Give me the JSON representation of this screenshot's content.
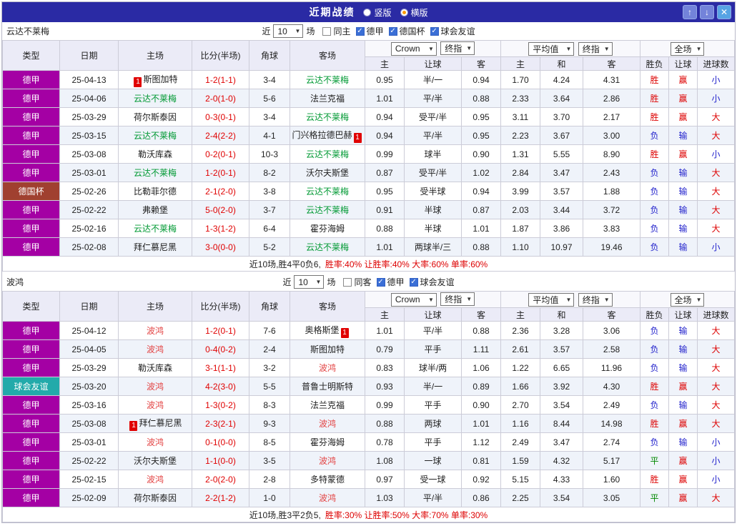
{
  "colors": {
    "type": {
      "德甲": "#a400a4",
      "德国杯": "#a04030",
      "球会友谊": "#22aaaa"
    },
    "result": {
      "胜": "#dd0000",
      "平": "#008800",
      "负": "#2222cc",
      "赢": "#dd0000",
      "输": "#2222cc",
      "大": "#dd0000",
      "小": "#2222cc"
    },
    "score": "#e00000",
    "titlebar_bg": "#2a2aa4"
  },
  "titlebar": {
    "title": "近期战绩",
    "layout_options": [
      {
        "label": "竖版",
        "selected": false
      },
      {
        "label": "横版",
        "selected": true
      }
    ],
    "up_icon": "↑",
    "down_icon": "↓",
    "close_icon": "✕"
  },
  "columns": {
    "type": "类型",
    "date": "日期",
    "home": "主场",
    "score": "比分(半场)",
    "corner": "角球",
    "away": "客场",
    "ah": [
      "主",
      "让球",
      "客"
    ],
    "eu": [
      "主",
      "和",
      "客"
    ],
    "res": [
      "胜负",
      "让球",
      "进球数"
    ]
  },
  "sections": [
    {
      "team": "云达不莱梅",
      "team_color": "#009933",
      "filter": {
        "prefix": "近",
        "count": "10",
        "suffix": "场",
        "checkboxes": [
          {
            "label": "同主",
            "checked": false
          },
          {
            "label": "德甲",
            "checked": true
          },
          {
            "label": "德国杯",
            "checked": true
          },
          {
            "label": "球会友谊",
            "checked": true
          }
        ]
      },
      "selects": {
        "asia_source": "Crown",
        "asia_time": "终指",
        "eu_source": "平均值",
        "eu_time": "终指",
        "scope": "全场"
      },
      "rows": [
        {
          "type": "德甲",
          "date": "25-04-13",
          "home": "斯图加特",
          "home_card": "before",
          "score": "1-2(1-1)",
          "corner": "3-4",
          "away": "云达不莱梅",
          "away_card": "",
          "ah": [
            "0.95",
            "半/一",
            "0.94"
          ],
          "eu": [
            "1.70",
            "4.24",
            "4.31"
          ],
          "res": [
            "胜",
            "赢",
            "小"
          ]
        },
        {
          "type": "德甲",
          "date": "25-04-06",
          "home": "云达不莱梅",
          "home_card": "",
          "score": "2-0(1-0)",
          "corner": "5-6",
          "away": "法兰克福",
          "away_card": "",
          "ah": [
            "1.01",
            "平/半",
            "0.88"
          ],
          "eu": [
            "2.33",
            "3.64",
            "2.86"
          ],
          "res": [
            "胜",
            "赢",
            "小"
          ]
        },
        {
          "type": "德甲",
          "date": "25-03-29",
          "home": "荷尔斯泰因",
          "home_card": "",
          "score": "0-3(0-1)",
          "corner": "3-4",
          "away": "云达不莱梅",
          "away_card": "",
          "ah": [
            "0.94",
            "受平/半",
            "0.95"
          ],
          "eu": [
            "3.11",
            "3.70",
            "2.17"
          ],
          "res": [
            "胜",
            "赢",
            "大"
          ]
        },
        {
          "type": "德甲",
          "date": "25-03-15",
          "home": "云达不莱梅",
          "home_card": "",
          "score": "2-4(2-2)",
          "corner": "4-1",
          "away": "门兴格拉德巴赫",
          "away_card": "after",
          "ah": [
            "0.94",
            "平/半",
            "0.95"
          ],
          "eu": [
            "2.23",
            "3.67",
            "3.00"
          ],
          "res": [
            "负",
            "输",
            "大"
          ]
        },
        {
          "type": "德甲",
          "date": "25-03-08",
          "home": "勒沃库森",
          "home_card": "",
          "score": "0-2(0-1)",
          "corner": "10-3",
          "away": "云达不莱梅",
          "away_card": "",
          "ah": [
            "0.99",
            "球半",
            "0.90"
          ],
          "eu": [
            "1.31",
            "5.55",
            "8.90"
          ],
          "res": [
            "胜",
            "赢",
            "小"
          ]
        },
        {
          "type": "德甲",
          "date": "25-03-01",
          "home": "云达不莱梅",
          "home_card": "",
          "score": "1-2(0-1)",
          "corner": "8-2",
          "away": "沃尔夫斯堡",
          "away_card": "",
          "ah": [
            "0.87",
            "受平/半",
            "1.02"
          ],
          "eu": [
            "2.84",
            "3.47",
            "2.43"
          ],
          "res": [
            "负",
            "输",
            "大"
          ]
        },
        {
          "type": "德国杯",
          "date": "25-02-26",
          "home": "比勒菲尔德",
          "home_card": "",
          "score": "2-1(2-0)",
          "corner": "3-8",
          "away": "云达不莱梅",
          "away_card": "",
          "ah": [
            "0.95",
            "受半球",
            "0.94"
          ],
          "eu": [
            "3.99",
            "3.57",
            "1.88"
          ],
          "res": [
            "负",
            "输",
            "大"
          ]
        },
        {
          "type": "德甲",
          "date": "25-02-22",
          "home": "弗赖堡",
          "home_card": "",
          "score": "5-0(2-0)",
          "corner": "3-7",
          "away": "云达不莱梅",
          "away_card": "",
          "ah": [
            "0.91",
            "半球",
            "0.87"
          ],
          "eu": [
            "2.03",
            "3.44",
            "3.72"
          ],
          "res": [
            "负",
            "输",
            "大"
          ]
        },
        {
          "type": "德甲",
          "date": "25-02-16",
          "home": "云达不莱梅",
          "home_card": "",
          "score": "1-3(1-2)",
          "corner": "6-4",
          "away": "霍芬海姆",
          "away_card": "",
          "ah": [
            "0.88",
            "半球",
            "1.01"
          ],
          "eu": [
            "1.87",
            "3.86",
            "3.83"
          ],
          "res": [
            "负",
            "输",
            "大"
          ]
        },
        {
          "type": "德甲",
          "date": "25-02-08",
          "home": "拜仁慕尼黑",
          "home_card": "",
          "score": "3-0(0-0)",
          "corner": "5-2",
          "away": "云达不莱梅",
          "away_card": "",
          "ah": [
            "1.01",
            "两球半/三",
            "0.88"
          ],
          "eu": [
            "1.10",
            "10.97",
            "19.46"
          ],
          "res": [
            "负",
            "输",
            "小"
          ]
        }
      ],
      "summary": {
        "text": "近10场,胜4平0负6,",
        "stats": "胜率:40% 让胜率:40% 大率:60% 单率:60%"
      }
    },
    {
      "team": "波鸿",
      "team_color": "#e34444",
      "filter": {
        "prefix": "近",
        "count": "10",
        "suffix": "场",
        "checkboxes": [
          {
            "label": "同客",
            "checked": false
          },
          {
            "label": "德甲",
            "checked": true
          },
          {
            "label": "球会友谊",
            "checked": true
          }
        ]
      },
      "selects": {
        "asia_source": "Crown",
        "asia_time": "终指",
        "eu_source": "平均值",
        "eu_time": "终指",
        "scope": "全场"
      },
      "rows": [
        {
          "type": "德甲",
          "date": "25-04-12",
          "home": "波鸿",
          "home_card": "",
          "score": "1-2(0-1)",
          "corner": "7-6",
          "away": "奥格斯堡",
          "away_card": "after",
          "ah": [
            "1.01",
            "平/半",
            "0.88"
          ],
          "eu": [
            "2.36",
            "3.28",
            "3.06"
          ],
          "res": [
            "负",
            "输",
            "大"
          ]
        },
        {
          "type": "德甲",
          "date": "25-04-05",
          "home": "波鸿",
          "home_card": "",
          "score": "0-4(0-2)",
          "corner": "2-4",
          "away": "斯图加特",
          "away_card": "",
          "ah": [
            "0.79",
            "平手",
            "1.11"
          ],
          "eu": [
            "2.61",
            "3.57",
            "2.58"
          ],
          "res": [
            "负",
            "输",
            "大"
          ]
        },
        {
          "type": "德甲",
          "date": "25-03-29",
          "home": "勒沃库森",
          "home_card": "",
          "score": "3-1(1-1)",
          "corner": "3-2",
          "away": "波鸿",
          "away_card": "",
          "ah": [
            "0.83",
            "球半/两",
            "1.06"
          ],
          "eu": [
            "1.22",
            "6.65",
            "11.96"
          ],
          "res": [
            "负",
            "输",
            "大"
          ]
        },
        {
          "type": "球会友谊",
          "date": "25-03-20",
          "home": "波鸿",
          "home_card": "",
          "score": "4-2(3-0)",
          "corner": "5-5",
          "away": "普鲁士明斯特",
          "away_card": "",
          "ah": [
            "0.93",
            "半/一",
            "0.89"
          ],
          "eu": [
            "1.66",
            "3.92",
            "4.30"
          ],
          "res": [
            "胜",
            "赢",
            "大"
          ]
        },
        {
          "type": "德甲",
          "date": "25-03-16",
          "home": "波鸿",
          "home_card": "",
          "score": "1-3(0-2)",
          "corner": "8-3",
          "away": "法兰克福",
          "away_card": "",
          "ah": [
            "0.99",
            "平手",
            "0.90"
          ],
          "eu": [
            "2.70",
            "3.54",
            "2.49"
          ],
          "res": [
            "负",
            "输",
            "大"
          ]
        },
        {
          "type": "德甲",
          "date": "25-03-08",
          "home": "拜仁慕尼黑",
          "home_card": "before",
          "score": "2-3(2-1)",
          "corner": "9-3",
          "away": "波鸿",
          "away_card": "",
          "ah": [
            "0.88",
            "两球",
            "1.01"
          ],
          "eu": [
            "1.16",
            "8.44",
            "14.98"
          ],
          "res": [
            "胜",
            "赢",
            "大"
          ]
        },
        {
          "type": "德甲",
          "date": "25-03-01",
          "home": "波鸿",
          "home_card": "",
          "score": "0-1(0-0)",
          "corner": "8-5",
          "away": "霍芬海姆",
          "away_card": "",
          "ah": [
            "0.78",
            "平手",
            "1.12"
          ],
          "eu": [
            "2.49",
            "3.47",
            "2.74"
          ],
          "res": [
            "负",
            "输",
            "小"
          ]
        },
        {
          "type": "德甲",
          "date": "25-02-22",
          "home": "沃尔夫斯堡",
          "home_card": "",
          "score": "1-1(0-0)",
          "corner": "3-5",
          "away": "波鸿",
          "away_card": "",
          "ah": [
            "1.08",
            "一球",
            "0.81"
          ],
          "eu": [
            "1.59",
            "4.32",
            "5.17"
          ],
          "res": [
            "平",
            "赢",
            "小"
          ]
        },
        {
          "type": "德甲",
          "date": "25-02-15",
          "home": "波鸿",
          "home_card": "",
          "score": "2-0(2-0)",
          "corner": "2-8",
          "away": "多特蒙德",
          "away_card": "",
          "ah": [
            "0.97",
            "受一球",
            "0.92"
          ],
          "eu": [
            "5.15",
            "4.33",
            "1.60"
          ],
          "res": [
            "胜",
            "赢",
            "小"
          ]
        },
        {
          "type": "德甲",
          "date": "25-02-09",
          "home": "荷尔斯泰因",
          "home_card": "",
          "score": "2-2(1-2)",
          "corner": "1-0",
          "away": "波鸿",
          "away_card": "",
          "ah": [
            "1.03",
            "平/半",
            "0.86"
          ],
          "eu": [
            "2.25",
            "3.54",
            "3.05"
          ],
          "res": [
            "平",
            "赢",
            "大"
          ]
        }
      ],
      "summary": {
        "text": "近10场,胜3平2负5,",
        "stats": "胜率:30% 让胜率:50% 大率:70% 单率:30%"
      }
    }
  ]
}
